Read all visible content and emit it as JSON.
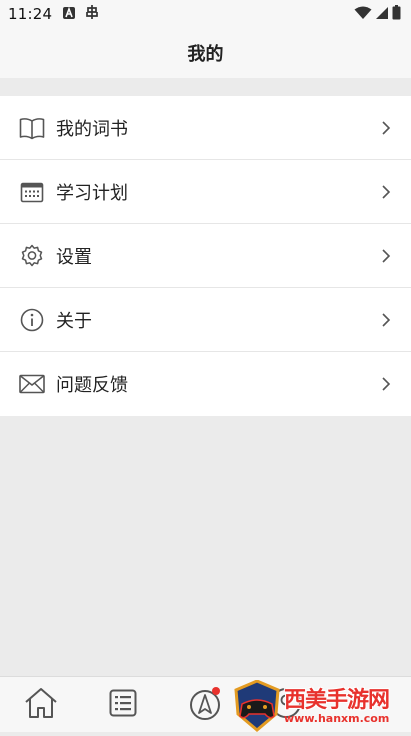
{
  "status_bar": {
    "time": "11:24",
    "left_icons": [
      "a-letter-icon",
      "bug-icon"
    ],
    "right_icons": [
      "wifi-icon",
      "signal-icon",
      "battery-icon"
    ]
  },
  "header": {
    "title": "我的"
  },
  "menu": {
    "items": [
      {
        "label": "我的词书",
        "icon": "book-icon"
      },
      {
        "label": "学习计划",
        "icon": "calendar-icon"
      },
      {
        "label": "设置",
        "icon": "gear-icon"
      },
      {
        "label": "关于",
        "icon": "info-icon"
      },
      {
        "label": "问题反馈",
        "icon": "mail-icon"
      }
    ]
  },
  "tabbar": {
    "tabs": [
      {
        "icon": "home-icon"
      },
      {
        "icon": "list-icon"
      },
      {
        "icon": "compass-icon",
        "badge": true
      },
      {
        "icon": "user-icon"
      }
    ]
  },
  "watermark": {
    "text": "西美手游网",
    "url": "www.hanxm.com",
    "icon": "game-controller-logo"
  },
  "colors": {
    "background": "#ebebeb",
    "surface": "#ffffff",
    "bar": "#f7f7f7",
    "text": "#222222",
    "badge": "#e8322d",
    "watermark": "#e8322d"
  }
}
